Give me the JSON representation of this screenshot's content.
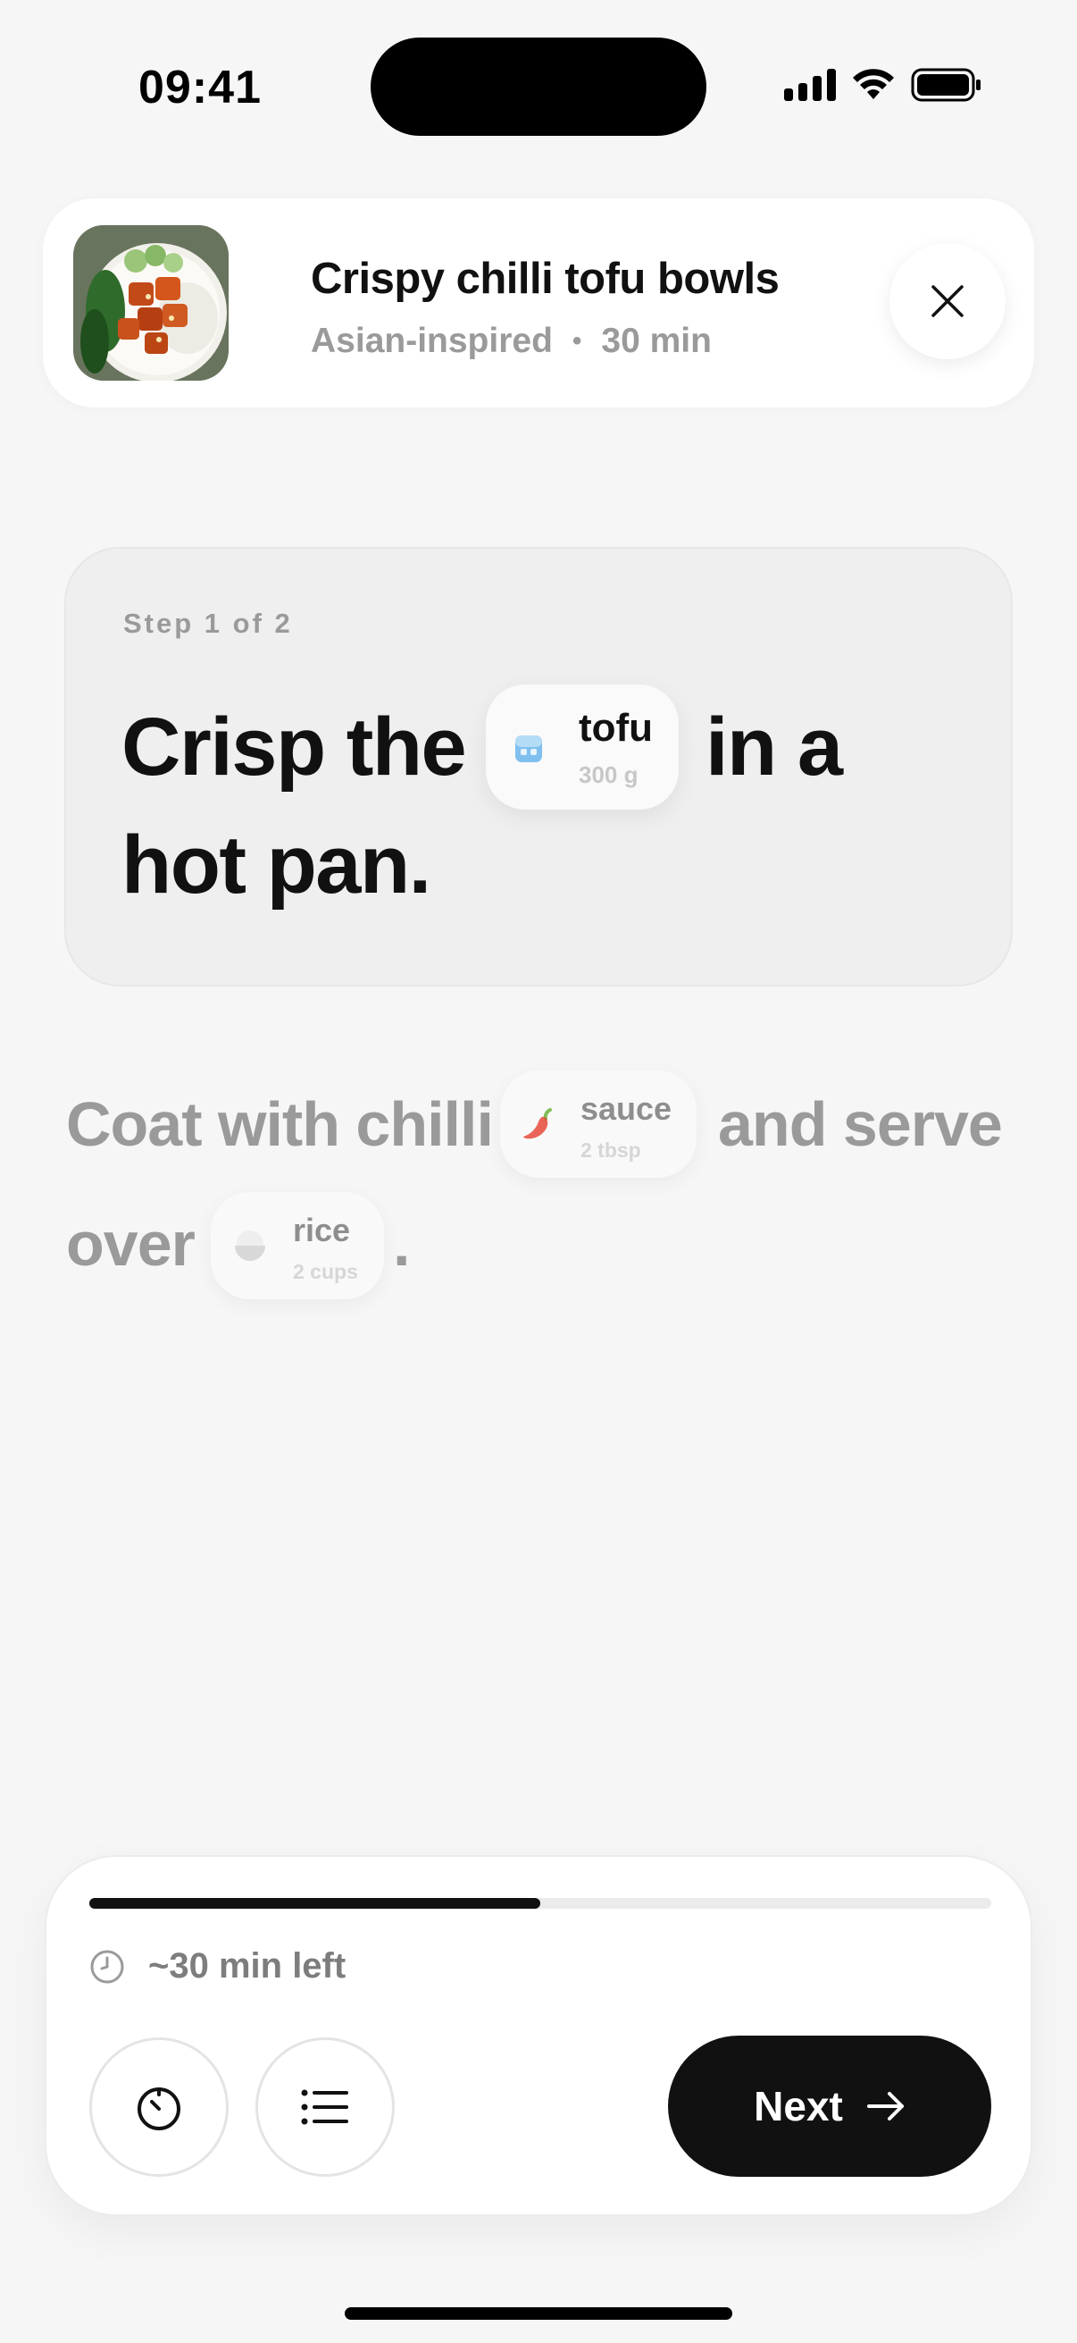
{
  "status_bar": {
    "time": "09:41"
  },
  "recipe": {
    "title": "Crispy chilli tofu bowls",
    "cuisine": "Asian-inspired",
    "separator": "•",
    "duration": "30 min",
    "thumbnail_icon": "tofu-bowl-photo"
  },
  "current_step": {
    "label": "Step 1 of 2",
    "text_before": "Crisp the",
    "text_after": "in a",
    "text_line2": "hot pan.",
    "ingredient": {
      "name": "tofu",
      "quantity": "300 g",
      "icon": "ice-cube-icon"
    }
  },
  "next_step": {
    "text_before": "Coat with chilli",
    "text_after": "and serve",
    "text_line2": "over",
    "text_end": ".",
    "ingredients": [
      {
        "name": "sauce",
        "quantity": "2 tbsp",
        "icon": "chili-pepper-icon"
      },
      {
        "name": "rice",
        "quantity": "2 cups",
        "icon": "rice-bowl-icon"
      }
    ]
  },
  "footer": {
    "progress": 0.5,
    "time_left": "~30 min left",
    "next_label": "Next"
  },
  "colors": {
    "background": "#f6f6f6",
    "accent": "#111111",
    "muted_text": "#9a9a9a"
  }
}
